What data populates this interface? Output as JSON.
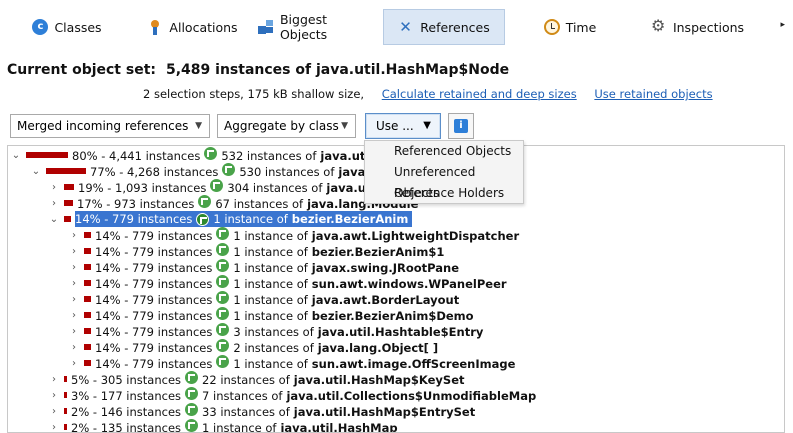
{
  "tabs": [
    {
      "label": "Classes",
      "icon": "classes-icon"
    },
    {
      "label": "Allocations",
      "icon": "allocations-icon"
    },
    {
      "label": "Biggest Objects",
      "icon": "biggest-objects-icon"
    },
    {
      "label": "References",
      "icon": "references-icon",
      "active": true
    },
    {
      "label": "Time",
      "icon": "time-icon"
    },
    {
      "label": "Inspections",
      "icon": "inspections-icon"
    }
  ],
  "header": {
    "label": "Current object set:",
    "value": "5,489 instances of java.util.HashMap$Node",
    "info": "2 selection steps, 175 kB shallow size,",
    "link_retained": "Calculate retained and deep sizes",
    "link_use_retained": "Use retained objects"
  },
  "controls": {
    "mode_select": "Merged incoming references",
    "aggregate_select": "Aggregate by class",
    "use_button": "Use ..."
  },
  "use_menu": [
    "Referenced Objects",
    "Unreferenced Objects",
    "Reference Holders"
  ],
  "tree": {
    "rows": [
      {
        "level": 0,
        "expanded": true,
        "pct": "80%",
        "count": "4,441 instances",
        "holder": "532 instances of",
        "cls": "java.util.HashMap$Node",
        "bar": 80
      },
      {
        "level": 1,
        "expanded": true,
        "pct": "77%",
        "count": "4,268 instances",
        "holder": "530 instances of",
        "cls": "java.util.HashMap$Node[ ]",
        "bar": 77
      },
      {
        "level": 2,
        "expanded": false,
        "pct": "19%",
        "count": "1,093 instances",
        "holder": "304 instances of",
        "cls": "java.util.HashMap",
        "bar": 19
      },
      {
        "level": 2,
        "expanded": false,
        "pct": "17%",
        "count": "973 instances",
        "holder": "67 instances of",
        "cls": "java.lang.Module",
        "bar": 17
      },
      {
        "level": 2,
        "expanded": true,
        "selected": true,
        "pct": "14%",
        "count": "779 instances",
        "holder": "1 instance of",
        "cls": "bezier.BezierAnim",
        "bar": 14
      },
      {
        "level": 3,
        "expanded": false,
        "pct": "14%",
        "count": "779 instances",
        "holder": "1 instance of",
        "cls": "java.awt.LightweightDispatcher",
        "bar": 14
      },
      {
        "level": 3,
        "expanded": false,
        "pct": "14%",
        "count": "779 instances",
        "holder": "1 instance of",
        "cls": "bezier.BezierAnim$1",
        "bar": 14
      },
      {
        "level": 3,
        "expanded": false,
        "pct": "14%",
        "count": "779 instances",
        "holder": "1 instance of",
        "cls": "javax.swing.JRootPane",
        "bar": 14
      },
      {
        "level": 3,
        "expanded": false,
        "pct": "14%",
        "count": "779 instances",
        "holder": "1 instance of",
        "cls": "sun.awt.windows.WPanelPeer",
        "bar": 14
      },
      {
        "level": 3,
        "expanded": false,
        "pct": "14%",
        "count": "779 instances",
        "holder": "1 instance of",
        "cls": "java.awt.BorderLayout",
        "bar": 14
      },
      {
        "level": 3,
        "expanded": false,
        "pct": "14%",
        "count": "779 instances",
        "holder": "1 instance of",
        "cls": "bezier.BezierAnim$Demo",
        "bar": 14
      },
      {
        "level": 3,
        "expanded": false,
        "pct": "14%",
        "count": "779 instances",
        "holder": "3 instances of",
        "cls": "java.util.Hashtable$Entry",
        "bar": 14
      },
      {
        "level": 3,
        "expanded": false,
        "pct": "14%",
        "count": "779 instances",
        "holder": "2 instances of",
        "cls": "java.lang.Object[ ]",
        "bar": 14
      },
      {
        "level": 3,
        "expanded": false,
        "pct": "14%",
        "count": "779 instances",
        "holder": "1 instance of",
        "cls": "sun.awt.image.OffScreenImage",
        "bar": 14
      },
      {
        "level": 2,
        "expanded": false,
        "pct": "5%",
        "count": "305 instances",
        "holder": "22 instances of",
        "cls": "java.util.HashMap$KeySet",
        "bar": 5
      },
      {
        "level": 2,
        "expanded": false,
        "pct": "3%",
        "count": "177 instances",
        "holder": "7 instances of",
        "cls": "java.util.Collections$UnmodifiableMap",
        "bar": 3
      },
      {
        "level": 2,
        "expanded": false,
        "pct": "2%",
        "count": "146 instances",
        "holder": "33 instances of",
        "cls": "java.util.HashMap$EntrySet",
        "bar": 2
      },
      {
        "level": 2,
        "expanded": false,
        "pct": "2%",
        "count": "135 instances",
        "holder": "1 instance of",
        "cls": "java.util.HashMap",
        "bar": 2
      }
    ]
  },
  "colors": {
    "accent": "#3a75d0",
    "bar": "#b00000",
    "link": "#1c5eb5",
    "ref_icon": "#4aa34a"
  }
}
